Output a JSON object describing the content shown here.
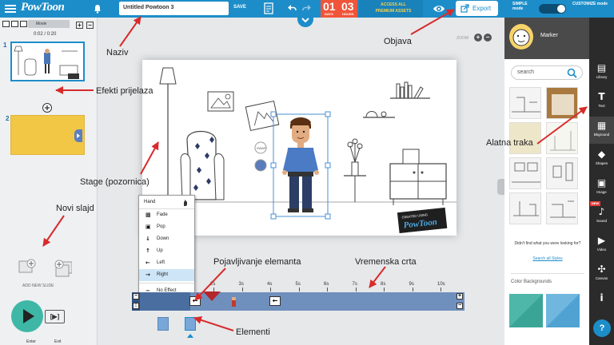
{
  "topbar": {
    "logo": "PowToon",
    "title": "Untitled Powtoon 3",
    "save_label": "SAVE",
    "timer_days": "01",
    "timer_hours": "03",
    "timer_days_label": "DAYS",
    "timer_hours_label": "HOURS",
    "promo_line1": "ACCESS ALL",
    "promo_line2": "PREMIUM ASSETS",
    "export_label": "Export",
    "simple_mode": "SIMPLE mode",
    "customize_mode": "CUSTOMIZE mode"
  },
  "slides_panel": {
    "tab_label": "Movie",
    "time": "0:02 / 0:20",
    "slide_numbers": [
      "1",
      "2"
    ],
    "add_new_slide": "ADD NEW SLIDE",
    "step_label": "[▶]",
    "enter_label": "Enter",
    "exit_label": "Exit"
  },
  "canvas": {
    "zoom_label": "ZOOM",
    "swap_label": "SWAP",
    "watermark_top": "CREATED USING",
    "watermark_brand": "PowToon"
  },
  "context_menu": {
    "header": "Hand",
    "items": [
      {
        "label": "Fade",
        "icon": "fade-icon",
        "selected": false
      },
      {
        "label": "Pop",
        "icon": "pop-icon",
        "selected": false
      },
      {
        "label": "Down",
        "icon": "arrow-down-icon",
        "selected": false
      },
      {
        "label": "Up",
        "icon": "arrow-up-icon",
        "selected": false
      },
      {
        "label": "Left",
        "icon": "arrow-left-icon",
        "selected": false
      },
      {
        "label": "Right",
        "icon": "arrow-right-icon",
        "selected": true
      }
    ],
    "no_effect": "No Effect"
  },
  "timeline": {
    "ticks": [
      "2s",
      "3s",
      "4s",
      "5s",
      "6s",
      "7s",
      "8s",
      "9s",
      "10s"
    ]
  },
  "right_panel": {
    "style_name": "Marker",
    "search_placeholder": "search",
    "not_found": "Didn't find what you were looking for?",
    "search_all": "Search all Styles",
    "color_backgrounds": "Color Backgrounds"
  },
  "tools": [
    {
      "label": "Library",
      "icon": "library-icon"
    },
    {
      "label": "Text",
      "icon": "text-icon"
    },
    {
      "label": "Bkground",
      "icon": "background-icon"
    },
    {
      "label": "Shapes",
      "icon": "shapes-icon"
    },
    {
      "label": "Image",
      "icon": "image-icon"
    },
    {
      "label": "Sound",
      "icon": "sound-icon"
    },
    {
      "label": "Video",
      "icon": "video-icon"
    },
    {
      "label": "Canvas",
      "icon": "canvas-icon"
    }
  ],
  "tools_new_badge": "NEW",
  "help_label": "?",
  "annotations": {
    "naziv": "Naziv",
    "objava": "Objava",
    "efekti": "Efekti prijelaza",
    "stage": "Stage (pozornica)",
    "alatna": "Alatna traka",
    "novi": "Novi slajd",
    "pojavljivanje": "Pojavljivanje elemanta",
    "vremenska": "Vremenska crta",
    "elementi": "Elementi"
  },
  "colors": {
    "topbar": "#1d8dc9",
    "timer": "#f0553a",
    "play": "#3fb7a7",
    "track": "#6f8fbd",
    "annotation_arrow": "#d72b2b"
  }
}
